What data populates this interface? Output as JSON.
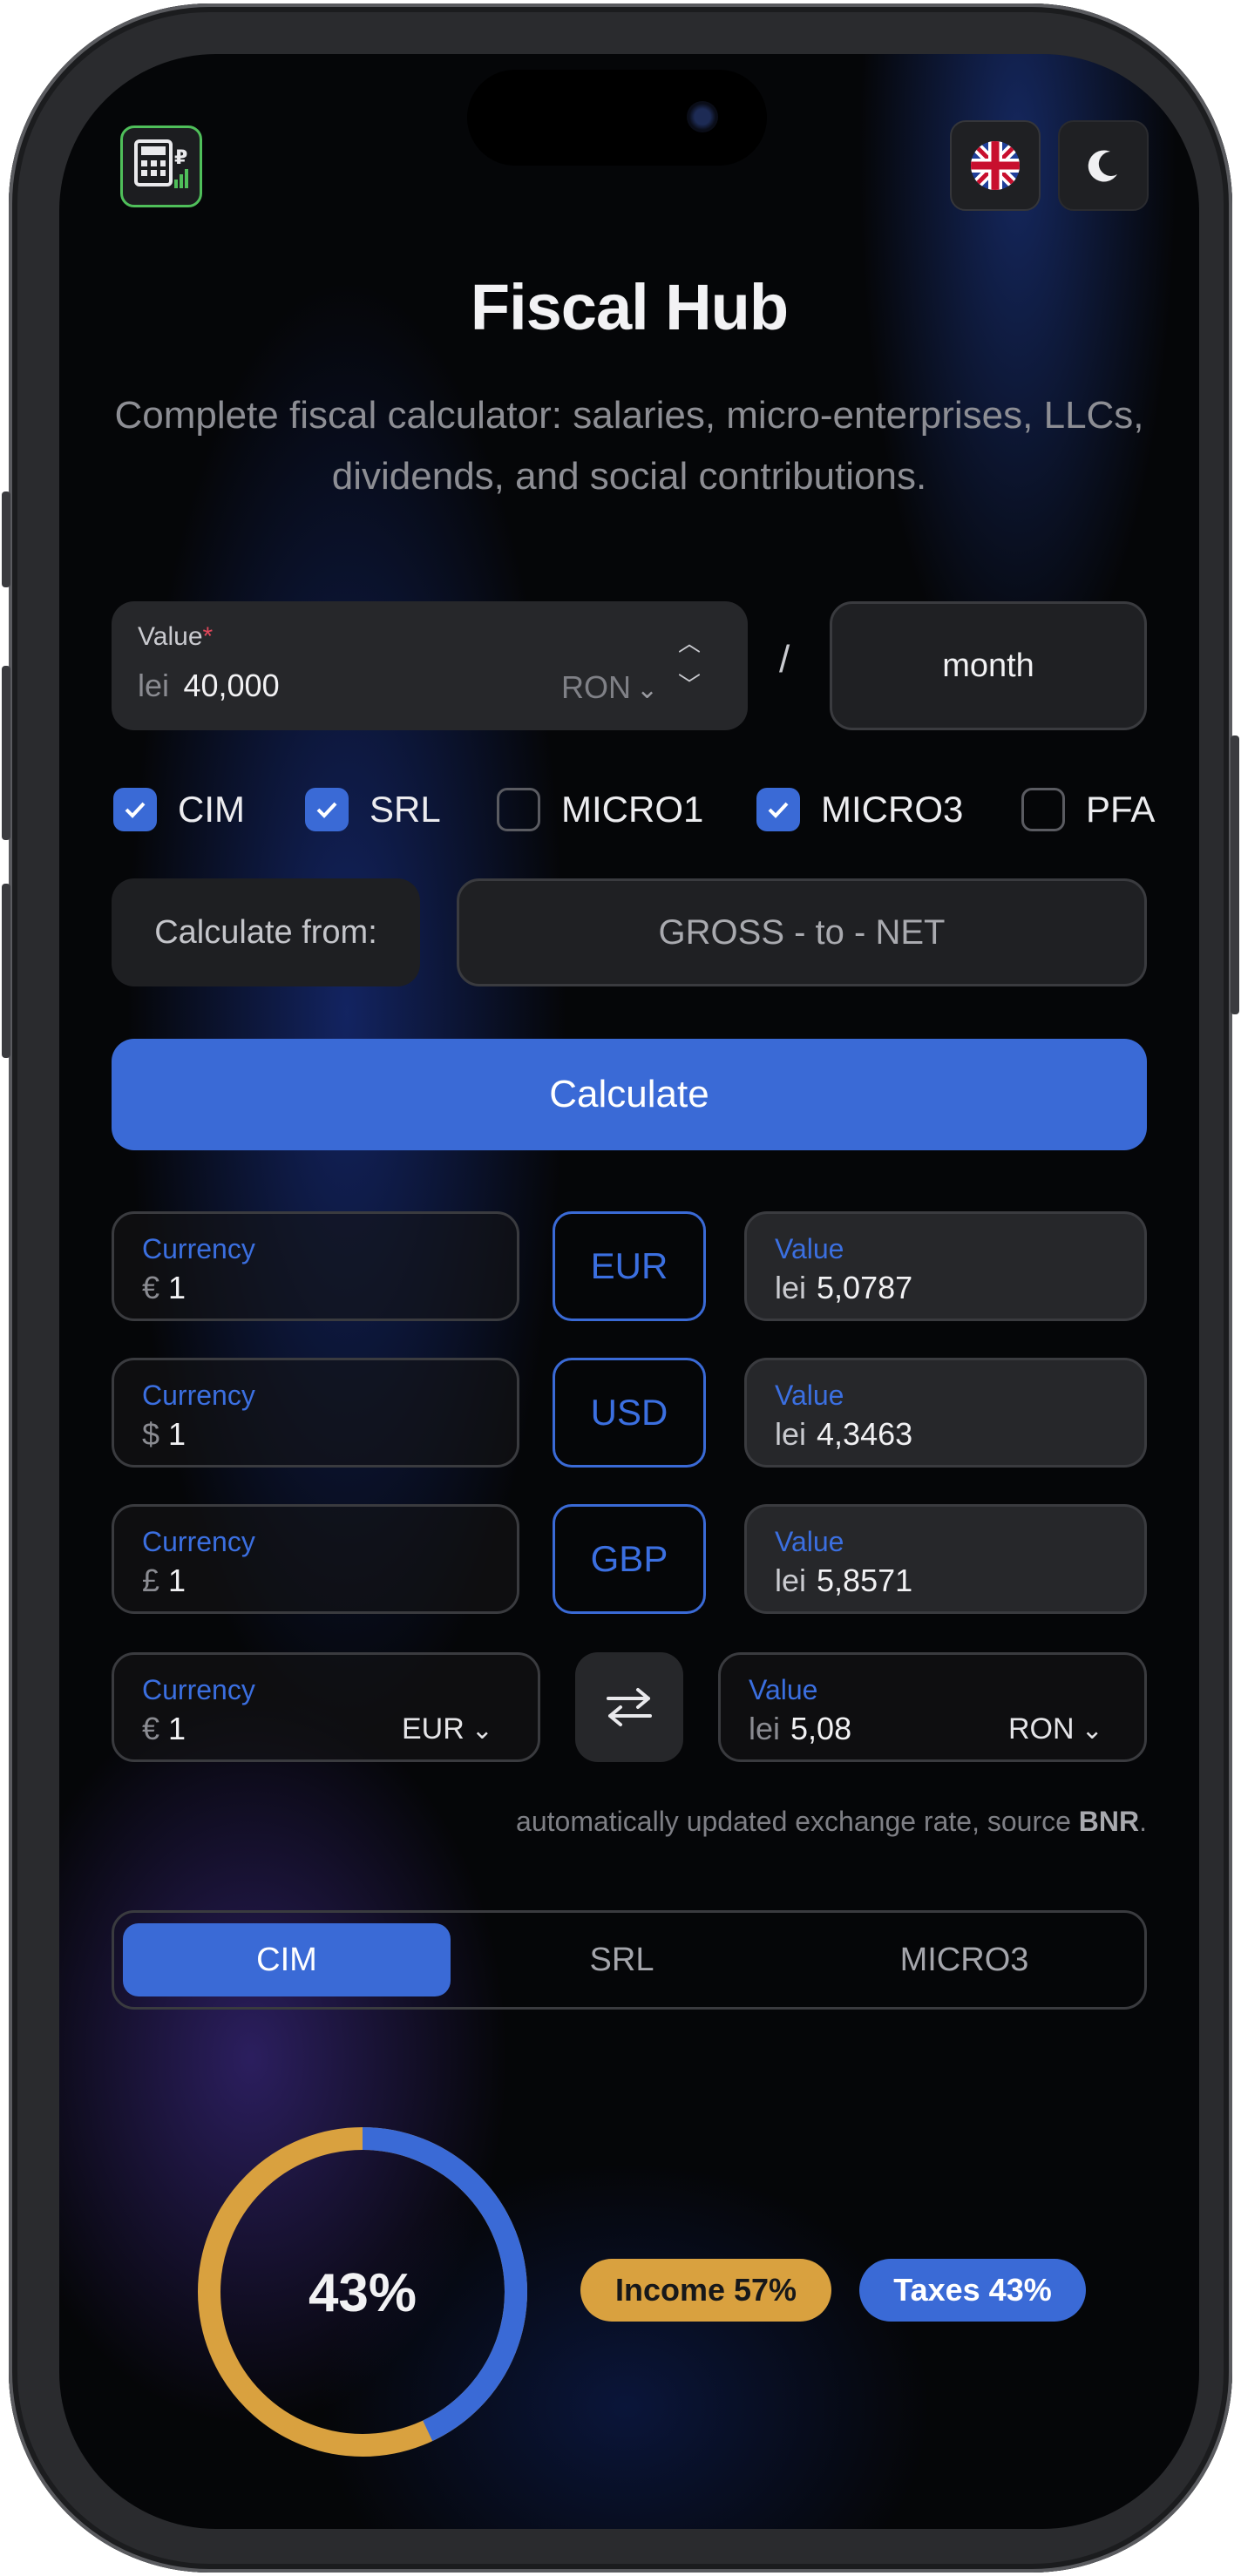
{
  "app": {
    "title": "Fiscal Hub",
    "subtitle": "Complete fiscal calculator: salaries, micro-enterprises, LLCs, dividends, and social contributions."
  },
  "value_input": {
    "label": "Value",
    "required_mark": "*",
    "prefix": "lei",
    "value": "40,000",
    "currency": "RON"
  },
  "separator": "/",
  "period": "month",
  "options": [
    {
      "label": "CIM",
      "checked": true
    },
    {
      "label": "SRL",
      "checked": true
    },
    {
      "label": "MICRO1",
      "checked": false
    },
    {
      "label": "MICRO3",
      "checked": true
    },
    {
      "label": "PFA",
      "checked": false
    }
  ],
  "calculate_from": {
    "label": "Calculate from:",
    "mode": "GROSS - to - NET"
  },
  "calculate_button": "Calculate",
  "exchange_rows": [
    {
      "currency_label": "Currency",
      "symbol": "€",
      "amount": "1",
      "code": "EUR",
      "value_label": "Value",
      "value_prefix": "lei",
      "value": "5,0787"
    },
    {
      "currency_label": "Currency",
      "symbol": "$",
      "amount": "1",
      "code": "USD",
      "value_label": "Value",
      "value_prefix": "lei",
      "value": "4,3463"
    },
    {
      "currency_label": "Currency",
      "symbol": "£",
      "amount": "1",
      "code": "GBP",
      "value_label": "Value",
      "value_prefix": "lei",
      "value": "5,8571"
    }
  ],
  "converter": {
    "from_label": "Currency",
    "from_symbol": "€",
    "from_amount": "1",
    "from_currency": "EUR",
    "to_label": "Value",
    "to_prefix": "lei",
    "to_amount": "5,08",
    "to_currency": "RON"
  },
  "note": {
    "text": "automatically updated exchange rate, source ",
    "source": "BNR",
    "end": "."
  },
  "tabs": [
    {
      "label": "CIM",
      "active": true
    },
    {
      "label": "SRL",
      "active": false
    },
    {
      "label": "MICRO3",
      "active": false
    }
  ],
  "result": {
    "center_label": "43%",
    "tax_fraction": 0.43,
    "income_pill": "Income 57%",
    "taxes_pill": "Taxes 43%"
  },
  "colors": {
    "accent": "#3a6ad6",
    "income": "#d9a13f",
    "taxes": "#3a6ad6",
    "logo_border": "#4fbf5a"
  }
}
